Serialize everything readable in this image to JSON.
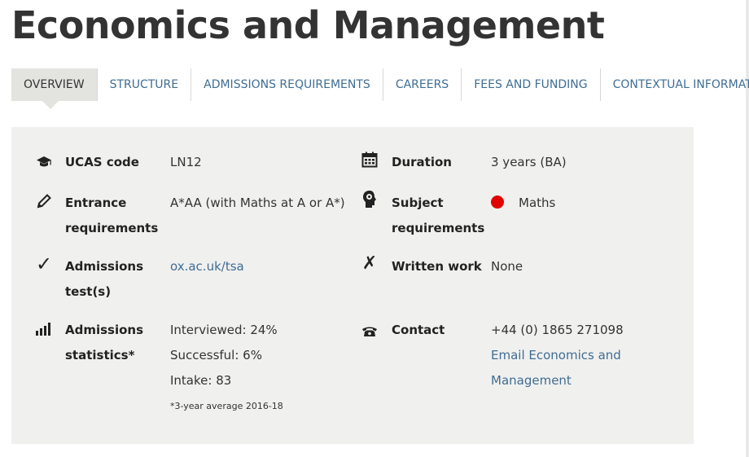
{
  "page": {
    "title": "Economics and Management"
  },
  "tabs": [
    {
      "label": "OVERVIEW",
      "active": true
    },
    {
      "label": "STRUCTURE"
    },
    {
      "label": "ADMISSIONS REQUIREMENTS"
    },
    {
      "label": "CAREERS"
    },
    {
      "label": "FEES AND FUNDING"
    },
    {
      "label": "CONTEXTUAL INFORMATION"
    }
  ],
  "overview": {
    "ucas": {
      "icon": "graduation-cap-icon",
      "label": "UCAS code",
      "value": "LN12"
    },
    "duration": {
      "icon": "calendar-icon",
      "label": "Duration",
      "value": "3 years (BA)"
    },
    "entrance": {
      "icon": "pencil-icon",
      "label_line1": "Entrance",
      "label_line2": "requirements",
      "value": "A*AA (with Maths at A or A*)"
    },
    "subject": {
      "icon": "head-gear-icon",
      "label_line1": "Subject",
      "label_line2": "requirements",
      "dot_color": "#e00000",
      "value": "Maths"
    },
    "test": {
      "icon": "checkmark-icon",
      "label_line1": "Admissions",
      "label_line2": "test(s)",
      "link": "ox.ac.uk/tsa"
    },
    "written": {
      "icon": "cross-icon",
      "label": "Written work",
      "value": "None"
    },
    "stats": {
      "icon": "bar-chart-icon",
      "label_line1": "Admissions",
      "label_line2": "statistics*",
      "interviewed": "Interviewed: 24%",
      "successful": "Successful: 6%",
      "intake": "Intake: 83",
      "note": "*3-year average 2016-18"
    },
    "contact": {
      "icon": "telephone-icon",
      "label": "Contact",
      "phone": "+44 (0) 1865 271098",
      "email_line1": "Email Economics and",
      "email_line2": "Management"
    }
  },
  "colors": {
    "link": "#3f6d93",
    "panel_bg": "#f0f0ef",
    "active_tab_bg": "#e3e3e0",
    "dot": "#e00000"
  }
}
